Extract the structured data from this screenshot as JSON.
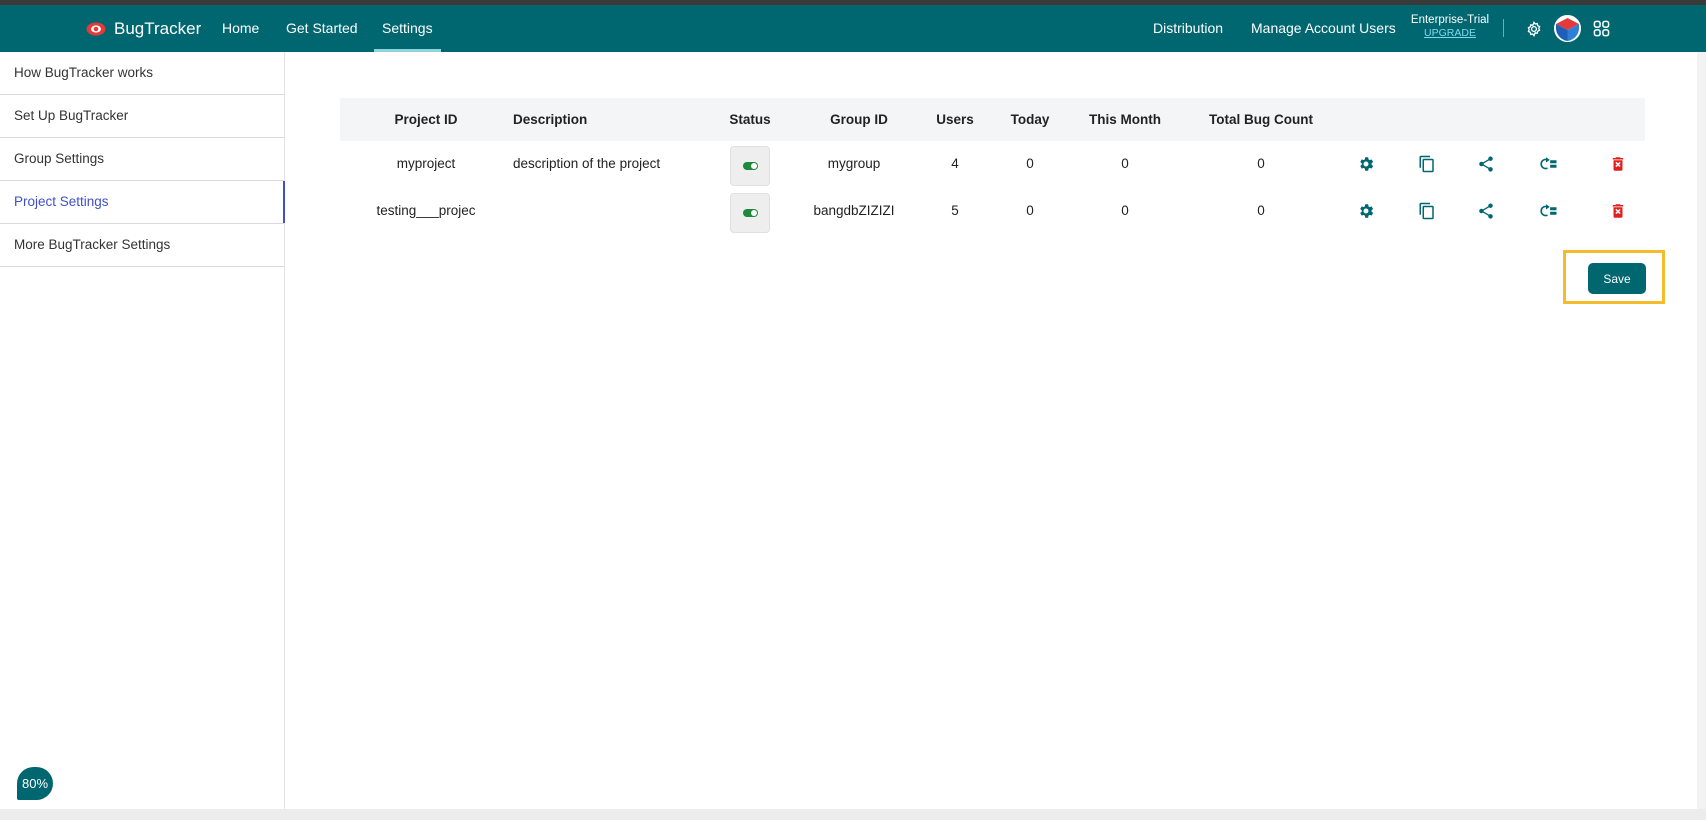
{
  "app": {
    "name": "BugTracker"
  },
  "nav": {
    "links": [
      "Home",
      "Get Started",
      "Settings"
    ],
    "active": "Settings",
    "right_links": [
      "Distribution",
      "Manage Account Users"
    ],
    "plan": "Enterprise-Trial",
    "upgrade": "UPGRADE"
  },
  "sidebar": {
    "items": [
      {
        "label": "How BugTracker works"
      },
      {
        "label": "Set Up BugTracker"
      },
      {
        "label": "Group Settings"
      },
      {
        "label": "Project Settings"
      },
      {
        "label": "More BugTracker Settings"
      }
    ],
    "active_index": 3
  },
  "table": {
    "headers": {
      "project_id": "Project ID",
      "description": "Description",
      "status": "Status",
      "group_id": "Group ID",
      "users": "Users",
      "today": "Today",
      "this_month": "This Month",
      "total_bug_count": "Total Bug Count"
    },
    "rows": [
      {
        "project_id": "myproject",
        "description": "description of the project",
        "status": "enabled",
        "group_id": "mygroup",
        "users": "4",
        "today": "0",
        "this_month": "0",
        "total_bug_count": "0"
      },
      {
        "project_id": "testing___projec",
        "description": "",
        "status": "enabled",
        "group_id": "bangdbZIZIZI",
        "users": "5",
        "today": "0",
        "this_month": "0",
        "total_bug_count": "0"
      }
    ],
    "row_actions": [
      "gear-icon",
      "copy-icon",
      "share-icon",
      "move-icon",
      "trash-icon"
    ]
  },
  "save": {
    "label": "Save"
  },
  "zoom": "80%",
  "colors": {
    "primary": "#006670",
    "active_link": "#3f4fc9",
    "delete": "#e0201f",
    "toggle_on": "#1e8a3c",
    "highlight": "#f4bc2c"
  }
}
